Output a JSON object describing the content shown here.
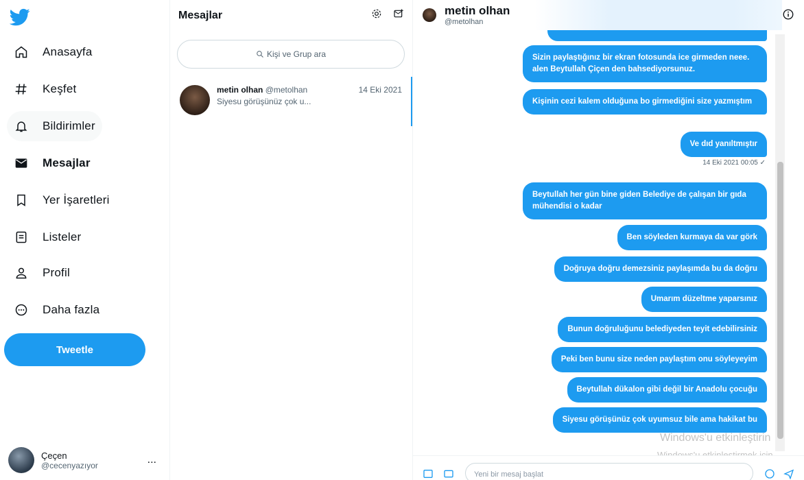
{
  "nav": {
    "items": [
      {
        "label": "Anasayfa",
        "icon": "home-icon"
      },
      {
        "label": "Keşfet",
        "icon": "hashtag-icon"
      },
      {
        "label": "Bildirimler",
        "icon": "bell-icon"
      },
      {
        "label": "Mesajlar",
        "icon": "mail-icon"
      },
      {
        "label": "Yer İşaretleri",
        "icon": "bookmark-icon"
      },
      {
        "label": "Listeler",
        "icon": "list-icon"
      },
      {
        "label": "Profil",
        "icon": "profile-icon"
      },
      {
        "label": "Daha fazla",
        "icon": "more-circle-icon"
      }
    ],
    "tweet_button": "Tweetle",
    "account": {
      "name": "Çeçen",
      "handle": "@cecenyazıyor",
      "more": "..."
    }
  },
  "list": {
    "title": "Mesajlar",
    "search_placeholder": "Kişi ve Grup ara",
    "conversations": [
      {
        "name": "metin olhan",
        "handle": "@metolhan",
        "date": "14 Eki 2021",
        "snippet": "Siyesu görüşünüz çok u..."
      }
    ]
  },
  "chat": {
    "name": "metin olhan",
    "handle": "@metolhan",
    "messages": [
      {
        "text": "Sizin paylaştığınız bir ekran fotosunda ice girmeden neee. alen Beytullah Çiçen den bahsediyorsunuz."
      },
      {
        "text": "Kişinin cezi kalem olduğuna bo girmediğini size yazmıştım"
      },
      {
        "text": "Ve dıd yanıltmıştır"
      },
      {
        "text": "Beytullah her gün bine giden Belediye de çalışan bir gıda mühendisi o kadar"
      },
      {
        "text": "Ben söyleden kurmaya da var görk"
      },
      {
        "text": "Doğruya doğru demezsiniz paylaşımda bu da doğru"
      },
      {
        "text": "Umarım düzeltme yaparsınız"
      },
      {
        "text": "Bunun doğruluğunu belediyeden teyit edebilirsiniz"
      },
      {
        "text": "Peki ben bunu size neden paylaştım onu söyleyeyim"
      },
      {
        "text": "Beytullah dükalon gibi değil bir Anadolu çocuğu"
      },
      {
        "text": "Siyesu görüşünüz çok uyumsuz bile ama hakikat bu"
      }
    ],
    "timestamp": "14 Eki 2021 00:05 ✓",
    "composer_placeholder": "Yeni bir mesaj başlat",
    "watermark_line1": "Windows'u etkinleştirin",
    "watermark_line2": "Windows'u etkinleştirmek için"
  },
  "colors": {
    "accent": "#1d9bf0",
    "text": "#0f1419",
    "muted": "#536471"
  }
}
